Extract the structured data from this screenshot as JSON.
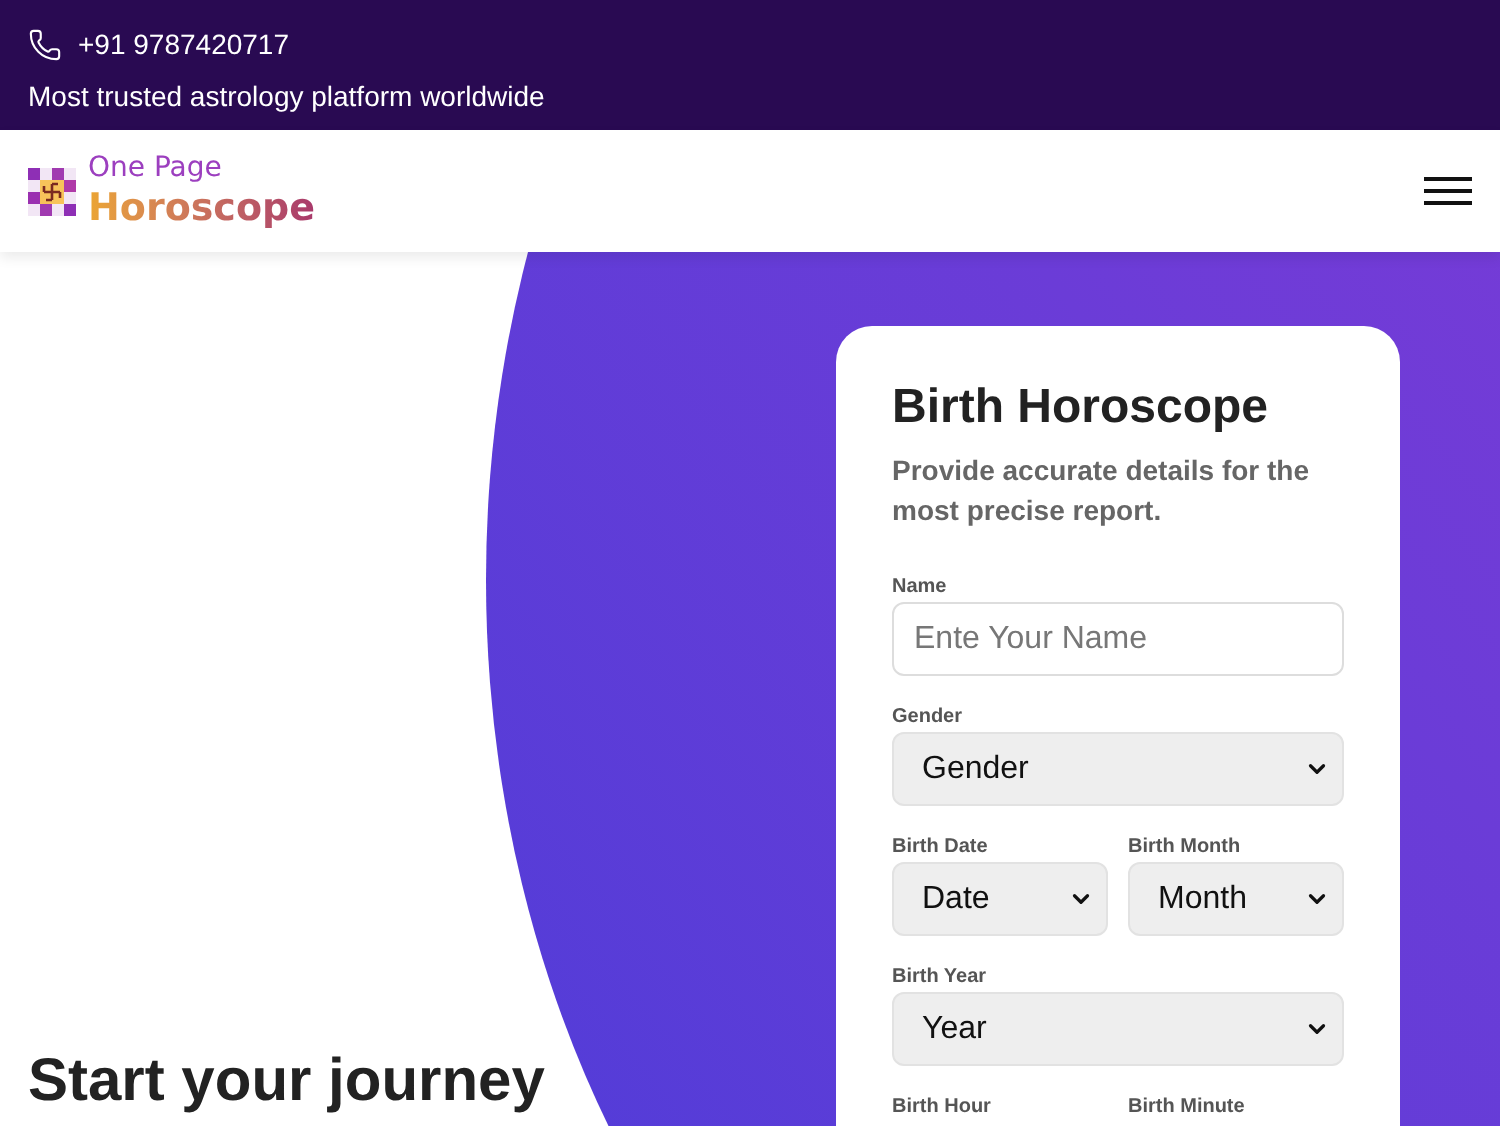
{
  "top_bar": {
    "phone": "+91 9787420717",
    "tagline": "Most trusted astrology platform worldwide"
  },
  "header": {
    "logo_line_1": "One Page",
    "logo_line_2": "Horoscope"
  },
  "hero": {
    "headline": "Start your journey"
  },
  "form": {
    "title": "Birth Horoscope",
    "subtitle": "Provide accurate details for the most precise report.",
    "rows": [
      {
        "fields": [
          {
            "label": "Name",
            "kind": "text",
            "placeholder": "Ente Your Name"
          }
        ]
      },
      {
        "fields": [
          {
            "label": "Gender",
            "kind": "select",
            "value": "Gender"
          }
        ]
      },
      {
        "fields": [
          {
            "label": "Birth Date",
            "kind": "select",
            "value": "Date"
          },
          {
            "label": "Birth Month",
            "kind": "select",
            "value": "Month"
          }
        ]
      },
      {
        "fields": [
          {
            "label": "Birth Year",
            "kind": "select",
            "value": "Year"
          }
        ]
      },
      {
        "fields": [
          {
            "label": "Birth Hour",
            "kind": "label"
          },
          {
            "label": "Birth Minute",
            "kind": "label"
          }
        ]
      }
    ]
  }
}
